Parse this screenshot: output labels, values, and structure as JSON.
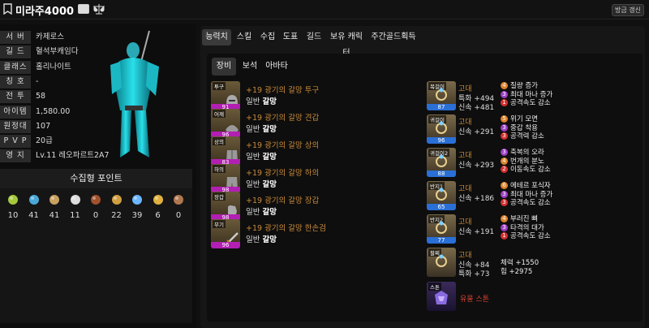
{
  "header": {
    "character_name": "미라주4000",
    "refresh_label": "방금 갱신",
    "pin_icon": "bookmark-icon",
    "card_icon": "id-card-icon",
    "scale_icon": "balance-scale-icon"
  },
  "profile": {
    "rows": [
      {
        "label": "서 버",
        "value": "카제로스"
      },
      {
        "label": "길 드",
        "value": "혈석부캐임다"
      },
      {
        "label": "클래스",
        "value": "홀리나이트"
      },
      {
        "label": "칭 호",
        "value": "-"
      },
      {
        "label": "전 투",
        "value": "58"
      },
      {
        "label": "아이템",
        "value": "1,580.00"
      },
      {
        "label": "원정대",
        "value": "107"
      },
      {
        "label": "P V P",
        "value": "20급"
      },
      {
        "label": "영 지",
        "value": "Lv.11 레오파르트2A7"
      }
    ]
  },
  "collection": {
    "title": "수집형 포인트",
    "items": [
      {
        "icon": "mokoko-seed-icon",
        "value": "10"
      },
      {
        "icon": "island-heart-icon",
        "value": "41"
      },
      {
        "icon": "great-art-icon",
        "value": "41"
      },
      {
        "icon": "giant-heart-icon",
        "value": "11"
      },
      {
        "icon": "ignea-token-icon",
        "value": "0"
      },
      {
        "icon": "adventure-book-icon",
        "value": "22"
      },
      {
        "icon": "world-tree-leaf-icon",
        "value": "39"
      },
      {
        "icon": "orpheus-star-icon",
        "value": "6"
      },
      {
        "icon": "sea-bounty-icon",
        "value": "0"
      }
    ]
  },
  "tabs": [
    "능력치",
    "스킬",
    "수집",
    "도표",
    "길드",
    "보유 캐릭터",
    "주간골드획득"
  ],
  "subtabs": [
    "장비",
    "보석",
    "아바타"
  ],
  "equipment": [
    {
      "slot": "투구",
      "quality": "91",
      "name": "+19 광기의 갈망 투구",
      "grade": "일반",
      "set": "갈망",
      "icon": "helmet-icon"
    },
    {
      "slot": "어깨",
      "quality": "96",
      "name": "+19 광기의 갈망 견갑",
      "grade": "일반",
      "set": "갈망",
      "icon": "shoulder-icon"
    },
    {
      "slot": "상의",
      "quality": "83",
      "name": "+19 광기의 갈망 상의",
      "grade": "일반",
      "set": "갈망",
      "icon": "chest-icon"
    },
    {
      "slot": "하의",
      "quality": "98",
      "name": "+19 광기의 갈망 하의",
      "grade": "일반",
      "set": "갈망",
      "icon": "pants-icon"
    },
    {
      "slot": "장갑",
      "quality": "98",
      "name": "+19 광기의 갈망 장갑",
      "grade": "일반",
      "set": "갈망",
      "icon": "gloves-icon"
    },
    {
      "slot": "무기",
      "quality": "96",
      "name": "+19 광기의 갈망 한손검",
      "grade": "일반",
      "set": "갈망",
      "icon": "sword-icon"
    }
  ],
  "accessories": [
    {
      "slot": "목걸이",
      "quality": "87",
      "grade": "고대",
      "stats": [
        "특화 +494",
        "신속 +481"
      ],
      "engravings": [
        {
          "level": "4",
          "name": "질량 증가",
          "color": "#d9822b"
        },
        {
          "level": "3",
          "name": "최대 마나 증가",
          "color": "#9b3fc0"
        },
        {
          "level": "1",
          "name": "공격속도 감소",
          "color": "#d23030"
        }
      ]
    },
    {
      "slot": "귀걸이",
      "quality": "96",
      "grade": "고대",
      "stats": [
        "신속 +291"
      ],
      "engravings": [
        {
          "level": "5",
          "name": "위기 모면",
          "color": "#d9822b"
        },
        {
          "level": "3",
          "name": "중갑 착용",
          "color": "#9b3fc0"
        },
        {
          "level": "3",
          "name": "공격력 감소",
          "color": "#d23030"
        }
      ]
    },
    {
      "slot": "귀걸이2",
      "quality": "88",
      "grade": "고대",
      "stats": [
        "신속 +293"
      ],
      "engravings": [
        {
          "level": "3",
          "name": "축복의 오라",
          "color": "#9b3fc0"
        },
        {
          "level": "4",
          "name": "번개의 분노",
          "color": "#d9822b"
        },
        {
          "level": "2",
          "name": "이동속도 감소",
          "color": "#d23030"
        }
      ]
    },
    {
      "slot": "반지1",
      "quality": "65",
      "grade": "고대",
      "stats": [
        "신속 +186"
      ],
      "engravings": [
        {
          "level": "6",
          "name": "에테르 포식자",
          "color": "#d9822b"
        },
        {
          "level": "3",
          "name": "최대 마나 증가",
          "color": "#9b3fc0"
        },
        {
          "level": "3",
          "name": "공격속도 감소",
          "color": "#d23030"
        }
      ]
    },
    {
      "slot": "반지2",
      "quality": "77",
      "grade": "고대",
      "stats": [
        "신속 +191"
      ],
      "engravings": [
        {
          "level": "4",
          "name": "부러진 뼈",
          "color": "#d9822b"
        },
        {
          "level": "3",
          "name": "타격의 대가",
          "color": "#9b3fc0"
        },
        {
          "level": "1",
          "name": "공격속도 감소",
          "color": "#d23030"
        }
      ]
    },
    {
      "slot": "팔찌",
      "quality": "",
      "grade": "고대",
      "stats": [
        "신속 +84",
        "특화 +73"
      ],
      "engravings": [
        {
          "level": "",
          "name": "체력 +1550",
          "color": ""
        },
        {
          "level": "",
          "name": "힘 +2975",
          "color": ""
        }
      ]
    }
  ],
  "stone": {
    "slot": "스톤",
    "name": "유물 스톤",
    "icon": "ability-stone-icon"
  }
}
